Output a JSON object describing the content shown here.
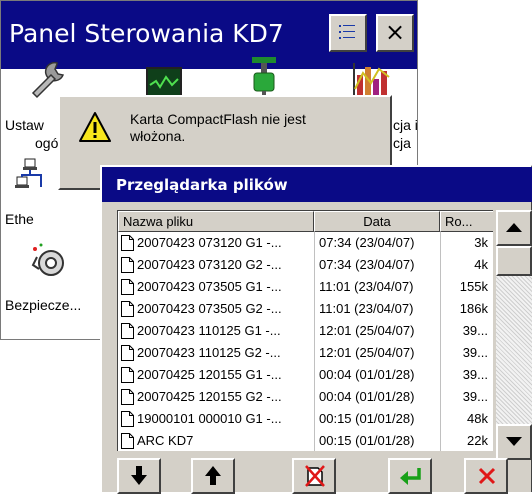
{
  "colors": {
    "titlebar": "#0a0a86",
    "dialog_face": "#d4d0c8",
    "warning_yellow": "#f8e61c",
    "confirm_green": "#18a018",
    "cancel_red": "#e01818"
  },
  "panel": {
    "title": "Panel Sterowania KD7",
    "menu_icon": "list-icon",
    "close_label": "×",
    "items": {
      "settings_label_1": "Ustaw",
      "settings_label_2": "ogó",
      "right_label_1": "cja i",
      "right_label_2": "cja",
      "ethernet_label": "Ethe",
      "security_label": "Bezpiecze..."
    }
  },
  "warning": {
    "message": "Karta CompactFlash nie jest włożona.",
    "icon": "warning-icon"
  },
  "file_browser": {
    "title": "Przeglądarka plików",
    "columns": [
      "Nazwa pliku",
      "Data",
      "Ro..."
    ],
    "rows": [
      {
        "name": "20070423 073120 G1 -...",
        "date": "07:34 (23/04/07)",
        "size": "3k"
      },
      {
        "name": "20070423 073120 G2 -...",
        "date": "07:34 (23/04/07)",
        "size": "4k"
      },
      {
        "name": "20070423 073505 G1 -...",
        "date": "11:01 (23/04/07)",
        "size": "155k"
      },
      {
        "name": "20070423 073505 G2 -...",
        "date": "11:01 (23/04/07)",
        "size": "186k"
      },
      {
        "name": "20070423 110125 G1 -...",
        "date": "12:01 (25/04/07)",
        "size": "39..."
      },
      {
        "name": "20070423 110125 G2 -...",
        "date": "12:01 (25/04/07)",
        "size": "39..."
      },
      {
        "name": "20070425 120155 G1 -...",
        "date": "00:04 (01/01/28)",
        "size": "39..."
      },
      {
        "name": "20070425 120155 G2 -...",
        "date": "00:04 (01/01/28)",
        "size": "39..."
      },
      {
        "name": "19000101 000010 G1 -...",
        "date": "00:15 (01/01/28)",
        "size": "48k"
      },
      {
        "name": "ARC KD7",
        "date": "00:15 (01/01/28)",
        "size": "22k"
      }
    ],
    "buttons": [
      "arrow-down-icon",
      "arrow-up-icon",
      "no-card-icon",
      "enter-icon",
      "cancel-icon"
    ]
  }
}
